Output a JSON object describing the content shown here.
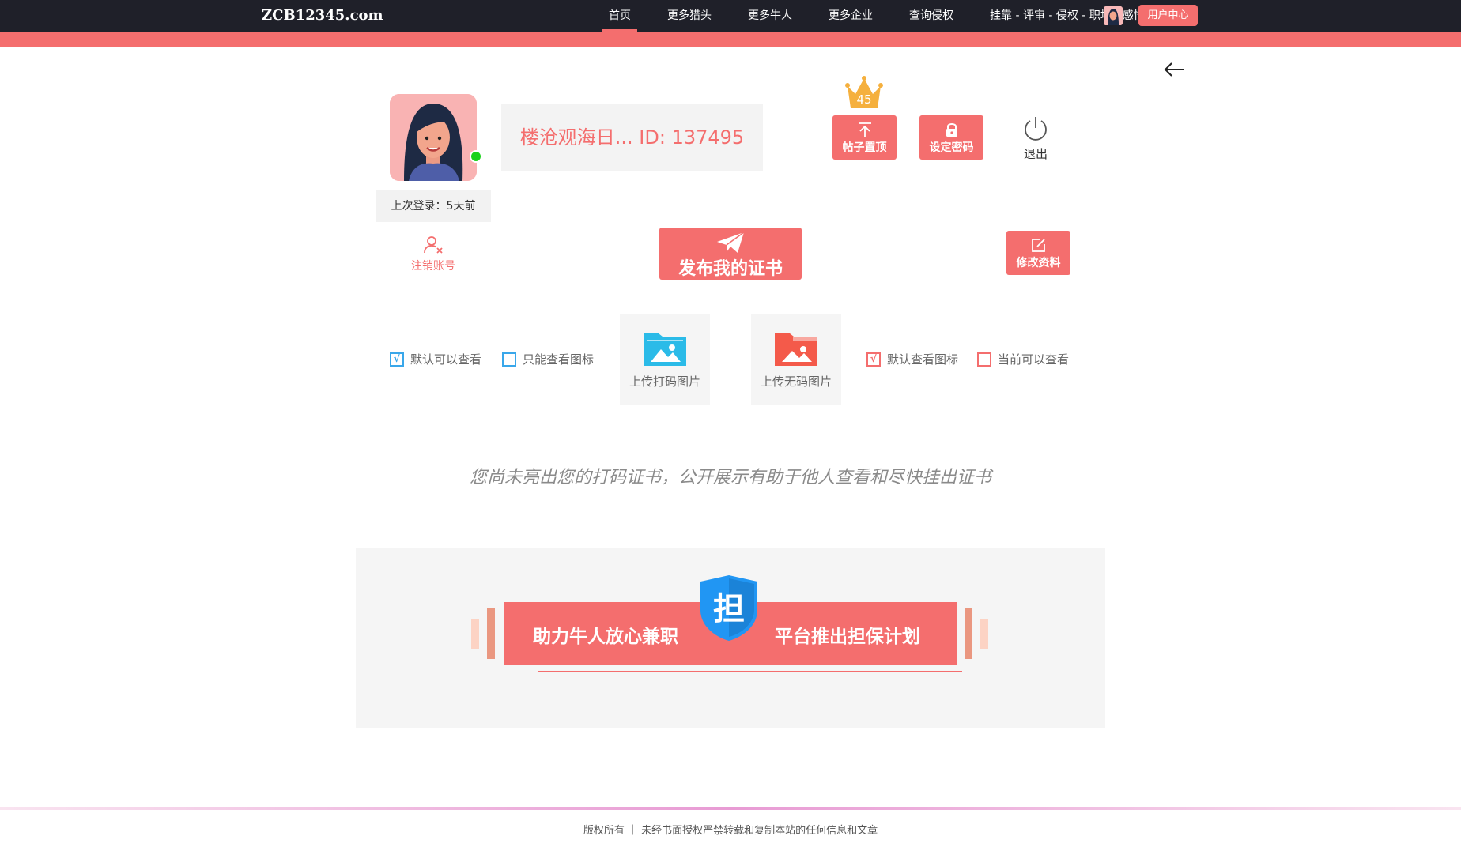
{
  "nav": {
    "brand": "ZCB12345.com",
    "items": [
      {
        "label": "首页"
      },
      {
        "label": "更多猎头"
      },
      {
        "label": "更多牛人"
      },
      {
        "label": "更多企业"
      },
      {
        "label": "查询侵权"
      },
      {
        "label": "挂靠 - 评审 - 侵权 - 职场 - 感悟"
      }
    ],
    "user_center": "用户中心"
  },
  "profile": {
    "name_id": "楼沧观海日...   ID: 137495",
    "last_login": "上次登录：5天前",
    "cancel_account": "注销账号",
    "level": "45"
  },
  "actions": {
    "pin_post": "帖子置顶",
    "set_password": "设定密码",
    "logout": "退出",
    "publish": "发布我的证书",
    "edit_profile": "修改资料"
  },
  "upload": {
    "check_default_visible": "默认可以查看",
    "check_only_icon": "只能查看图标",
    "upload_watermarked": "上传打码图片",
    "upload_clean": "上传无码图片",
    "check_default_icon": "默认查看图标",
    "check_current_visible": "当前可以查看"
  },
  "hint": "您尚未亮出您的打码证书，公开展示有助于他人查看和尽快挂出证书",
  "banner": {
    "left_text": "助力牛人放心兼职",
    "right_text": "平台推出担保计划",
    "shield_char": "担"
  },
  "footer": "版权所有 ｜ 未经书面授权严禁转载和复制本站的任何信息和文章",
  "colors": {
    "accent": "#f46e6e",
    "nav_bg": "#1f2029",
    "blue": "#39a7ea",
    "online": "#1bd21b"
  }
}
